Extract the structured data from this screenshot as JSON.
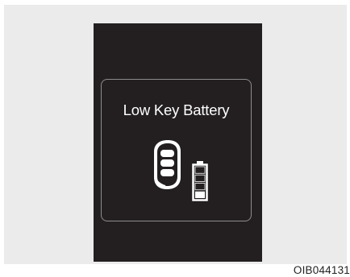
{
  "display": {
    "warning_message": "Low Key Battery",
    "key_icon": "smart-key-fob-icon",
    "battery_icon": "low-battery-icon",
    "battery_level": 0.25
  },
  "figure": {
    "image_code": "OIB044131"
  },
  "colors": {
    "screen_background": "#231f20",
    "panel_background": "#ebebeb",
    "icon_white": "#ffffff",
    "frame_gray": "#8d8d8d"
  }
}
